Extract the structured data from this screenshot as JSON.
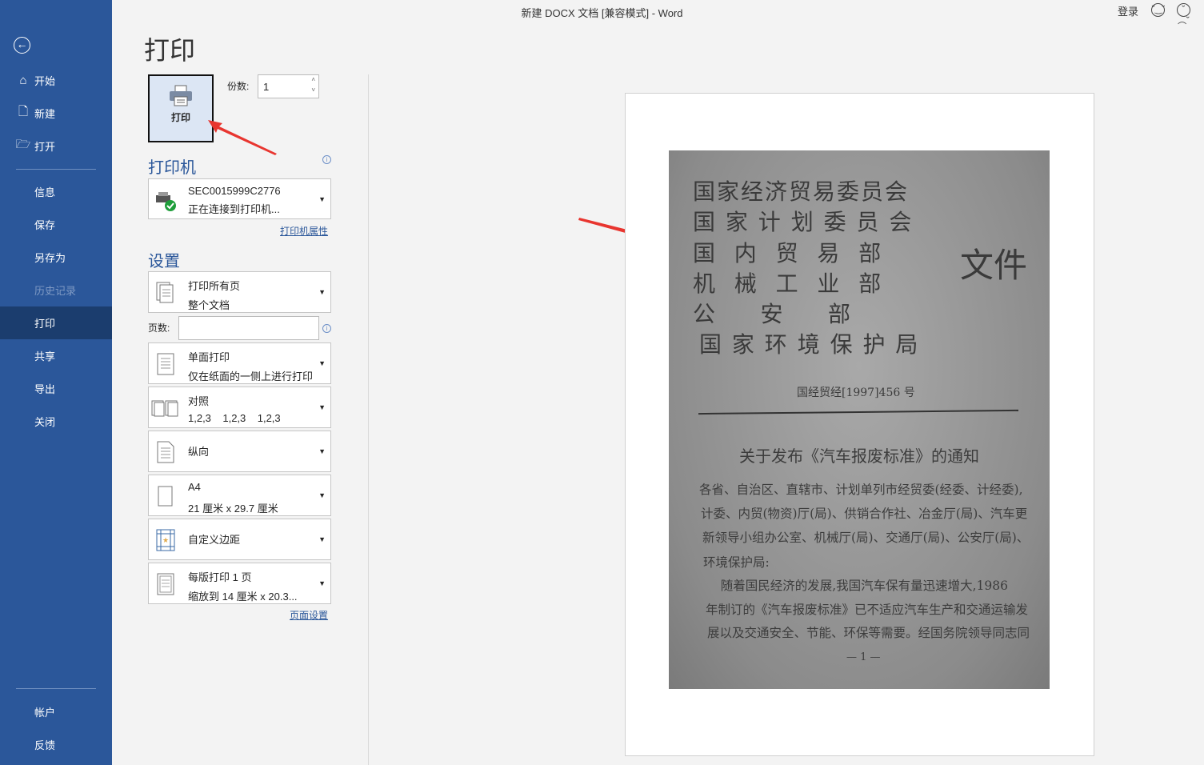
{
  "window": {
    "title": "新建 DOCX 文档 [兼容模式]  -  Word",
    "login": "登录",
    "smile_icon": "smile-icon",
    "frown_icon": "frown-icon"
  },
  "sidebar": {
    "items": [
      {
        "label": "开始",
        "icon": "⌂"
      },
      {
        "label": "新建",
        "icon": "🗋"
      },
      {
        "label": "打开",
        "icon": "🗁"
      },
      {
        "label": "信息"
      },
      {
        "label": "保存"
      },
      {
        "label": "另存为"
      },
      {
        "label": "历史记录"
      },
      {
        "label": "打印"
      },
      {
        "label": "共享"
      },
      {
        "label": "导出"
      },
      {
        "label": "关闭"
      }
    ],
    "bottom": [
      {
        "label": "帐户"
      },
      {
        "label": "反馈"
      }
    ]
  },
  "main": {
    "title": "打印",
    "print_button": "打印",
    "copies_label": "份数:",
    "copies_value": "1",
    "printer_heading": "打印机",
    "printer_name": "SEC0015999C2776",
    "printer_status": "正在连接到打印机...",
    "printer_props": "打印机属性",
    "settings_heading": "设置",
    "pages_label": "页数:",
    "pages_value": "",
    "settings": [
      {
        "l1": "打印所有页",
        "l2": "整个文档"
      },
      {
        "l1": "单面打印",
        "l2": "仅在纸面的一侧上进行打印"
      },
      {
        "l1": "对照",
        "l2": "1,2,3    1,2,3    1,2,3"
      },
      {
        "l1": "纵向",
        "l2": ""
      },
      {
        "l1": "A4",
        "l2": "21 厘米 x 29.7 厘米"
      },
      {
        "l1": "自定义边距",
        "l2": ""
      },
      {
        "l1": "每版打印 1 页",
        "l2": "缩放到 14 厘米 x 20.3..."
      }
    ],
    "page_setup": "页面设置"
  },
  "preview": {
    "heads": [
      "国家经济贸易委员会",
      "国 家 计 划 委 员 会",
      "国  内  贸  易  部",
      "机  械  工  业  部",
      "公     安     部",
      "国 家 环 境 保 护 局"
    ],
    "wenjian": "文件",
    "docno": "国经贸经[1997]456 号",
    "doc_title": "关于发布《汽车报废标准》的通知",
    "body": [
      "各省、自治区、直辖市、计划单列市经贸委(经委、计经委),",
      "计委、内贸(物资)厅(局)、供销合作社、冶金厅(局)、汽车更",
      "新领导小组办公室、机械厅(局)、交通厅(局)、公安厅(局)、",
      "环境保护局:",
      "    随着国民经济的发展,我国汽车保有量迅速增大,1986",
      "年制订的《汽车报废标准》已不适应汽车生产和交通运输发",
      "展以及交通安全、节能、环保等需要。经国务院领导同志同"
    ],
    "page_no": "— 1 —"
  }
}
